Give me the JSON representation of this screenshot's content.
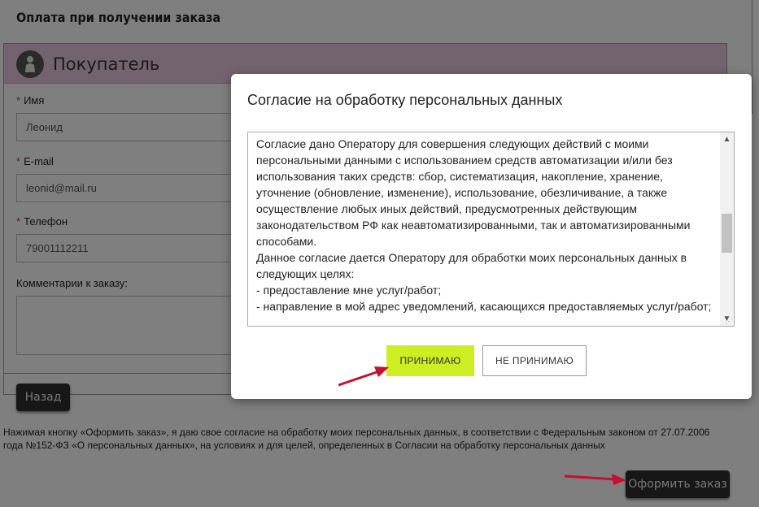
{
  "page": {
    "title": "Оплата при получении заказа"
  },
  "buyer": {
    "title": "Покупатель",
    "fields": [
      {
        "label": "Имя",
        "required": "*",
        "value": "Леонид"
      },
      {
        "label": "E-mail",
        "required": "*",
        "value": "leonid@mail.ru"
      },
      {
        "label": "Телефон",
        "required": "*",
        "value": "79001112211"
      }
    ],
    "comment_label": "Комментарии к заказу:",
    "comment_value": "",
    "back_label": "Назад"
  },
  "consent_note": "Нажимая кнопку «Оформить заказ», я даю свое согласие на обработку моих персональных данных, в соответствии с Федеральным законом от 27.07.2006 года №152-ФЗ «О персональных данных», на условиях и для целей, определенных в Согласии на обработку персональных данных",
  "submit_label": "Оформить заказ",
  "modal": {
    "title": "Согласие на обработку персональных данных",
    "text": "Согласие дано Оператору для совершения следующих действий с моими персональными данными с использованием средств автоматизации и/или без использования таких средств: сбор, систематизация, накопление, хранение, уточнение (обновление, изменение), использование, обезличивание, а также осуществление любых иных действий, предусмотренных действующим законодательством РФ как неавтоматизированными, так и автоматизированными способами.\nДанное согласие дается Оператору для обработки моих персональных данных в следующих целях:\n- предоставление мне услуг/работ;\n- направление в мой адрес уведомлений, касающихся предоставляемых услуг/работ;",
    "accept_label": "ПРИНИМАЮ",
    "decline_label": "НЕ ПРИНИМАЮ"
  },
  "colors": {
    "buyer_header": "#e7c6df",
    "accept_button": "#ccee22",
    "arrow": "#c8102e"
  }
}
